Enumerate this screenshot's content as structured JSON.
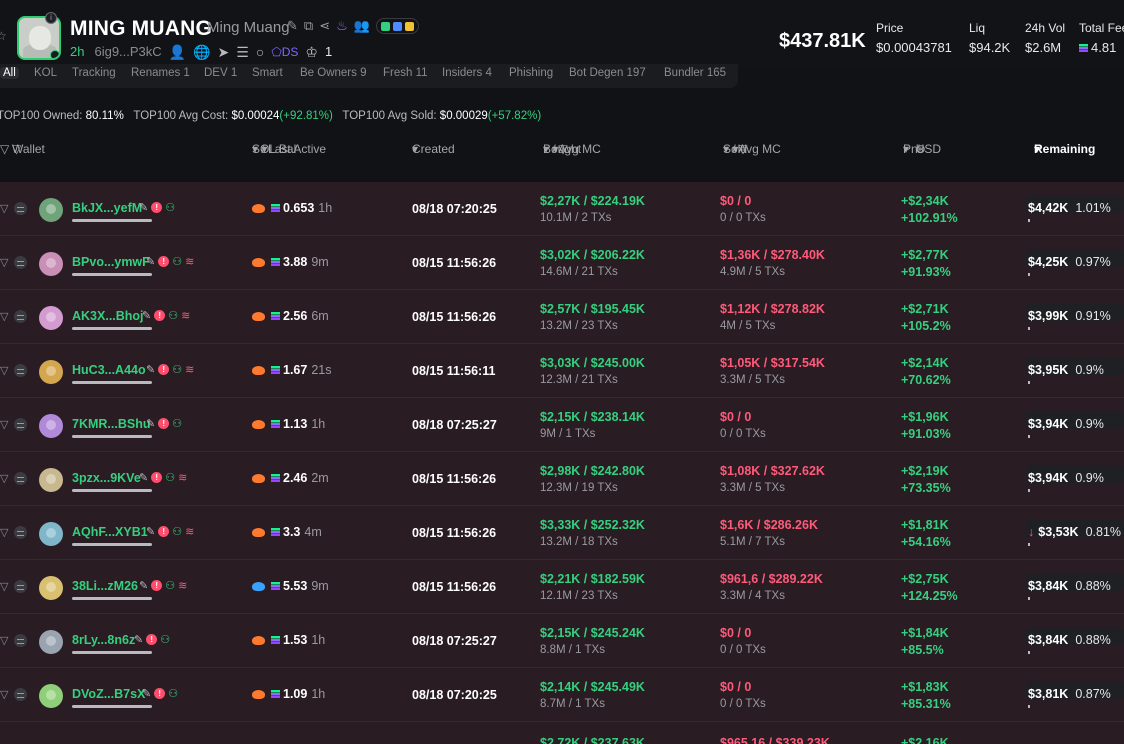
{
  "token": {
    "symbol": "MING MUANG",
    "name": "Ming Muang",
    "age": "2h",
    "contract": "6ig9...P3kC",
    "holders_icon_count": "1",
    "ds_label": "DS"
  },
  "stats": {
    "market_cap": "$437.81K",
    "price_label": "Price",
    "price": "$0.00043781",
    "liq_label": "Liq",
    "liq": "$94.2K",
    "vol_label": "24h Vol",
    "vol": "$2.6M",
    "fees_label": "Total Fee",
    "fees": "4.81"
  },
  "tabs": [
    {
      "label": "All"
    },
    {
      "label": "KOL"
    },
    {
      "label": "Tracking"
    },
    {
      "label": "Renames 1"
    },
    {
      "label": "DEV 1"
    },
    {
      "label": "Smart"
    },
    {
      "label": "Be Owners 9"
    },
    {
      "label": "Fresh 11"
    },
    {
      "label": "Insiders 4"
    },
    {
      "label": "Phishing"
    },
    {
      "label": "Bot Degen 197"
    },
    {
      "label": "Bundler 165"
    }
  ],
  "summary": {
    "owned_label": "TOP100 Owned:",
    "owned": "80.11%",
    "avg_cost_label": "TOP100 Avg Cost:",
    "avg_cost": "$0.00024",
    "avg_cost_change": "(+92.81%)",
    "avg_sold_label": "TOP100 Avg Sold:",
    "avg_sold": "$0.00029",
    "avg_sold_change": "(+57.82%)"
  },
  "columns": {
    "wallet": "Wallet",
    "sol_bal": "SOL Bal",
    "last_active": "/ Last Active",
    "created": "Created",
    "bought": "Bought",
    "bought_avg": "/ Avg MC",
    "sold": "Sold",
    "sold_avg": "/ Avg MC",
    "pnl": "Pnl",
    "usd": "USD",
    "remaining": "Remaining"
  },
  "rows": [
    {
      "wallet": "BkJX...yefM",
      "sol": "0.653",
      "active": "1h",
      "created": "08/18 07:20:25",
      "bought": "$2,27K / $224.19K",
      "bought_sub": "10.1M / 2 TXs",
      "sold": "$0 / 0",
      "sold_sub": "0 / 0 TXs",
      "pnl": "+$2,34K",
      "pnl_pct": "+102.91%",
      "remaining": "$4,42K",
      "rem_pct": "1.01%",
      "avatar_color": "#6fa37a",
      "exch": "fire",
      "layers": false,
      "down": false
    },
    {
      "wallet": "BPvo...ymwF",
      "sol": "3.88",
      "active": "9m",
      "created": "08/15 11:56:26",
      "bought": "$3,02K / $206.22K",
      "bought_sub": "14.6M / 21 TXs",
      "sold": "$1,36K / $278.40K",
      "sold_sub": "4.9M / 5 TXs",
      "pnl": "+$2,77K",
      "pnl_pct": "+91.93%",
      "remaining": "$4,25K",
      "rem_pct": "0.97%",
      "avatar_color": "#c98fb6",
      "exch": "fire",
      "layers": true,
      "down": false
    },
    {
      "wallet": "AK3X...Bhoj",
      "sol": "2.56",
      "active": "6m",
      "created": "08/15 11:56:26",
      "bought": "$2,57K / $195.45K",
      "bought_sub": "13.2M / 23 TXs",
      "sold": "$1,12K / $278.82K",
      "sold_sub": "4M / 5 TXs",
      "pnl": "+$2,71K",
      "pnl_pct": "+105.2%",
      "remaining": "$3,99K",
      "rem_pct": "0.91%",
      "avatar_color": "#d39bd0",
      "exch": "fire",
      "layers": true,
      "down": false
    },
    {
      "wallet": "HuC3...A44o",
      "sol": "1.67",
      "active": "21s",
      "created": "08/15 11:56:11",
      "bought": "$3,03K / $245.00K",
      "bought_sub": "12.3M / 21 TXs",
      "sold": "$1,05K / $317.54K",
      "sold_sub": "3.3M / 5 TXs",
      "pnl": "+$2,14K",
      "pnl_pct": "+70.62%",
      "remaining": "$3,95K",
      "rem_pct": "0.9%",
      "avatar_color": "#d4a74f",
      "exch": "fire",
      "layers": true,
      "down": false
    },
    {
      "wallet": "7KMR...BShu",
      "sol": "1.13",
      "active": "1h",
      "created": "08/18 07:25:27",
      "bought": "$2,15K / $238.14K",
      "bought_sub": "9M / 1 TXs",
      "sold": "$0 / 0",
      "sold_sub": "0 / 0 TXs",
      "pnl": "+$1,96K",
      "pnl_pct": "+91.03%",
      "remaining": "$3,94K",
      "rem_pct": "0.9%",
      "avatar_color": "#b08ad8",
      "exch": "fire",
      "layers": false,
      "down": false
    },
    {
      "wallet": "3pzx...9KVe",
      "sol": "2.46",
      "active": "2m",
      "created": "08/15 11:56:26",
      "bought": "$2,98K / $242.80K",
      "bought_sub": "12.3M / 19 TXs",
      "sold": "$1,08K / $327.62K",
      "sold_sub": "3.3M / 5 TXs",
      "pnl": "+$2,19K",
      "pnl_pct": "+73.35%",
      "remaining": "$3,94K",
      "rem_pct": "0.9%",
      "avatar_color": "#c8b890",
      "exch": "fire",
      "layers": true,
      "down": false
    },
    {
      "wallet": "AQhF...XYB1",
      "sol": "3.3",
      "active": "4m",
      "created": "08/15 11:56:26",
      "bought": "$3,33K / $252.32K",
      "bought_sub": "13.2M / 18 TXs",
      "sold": "$1,6K / $286.26K",
      "sold_sub": "5.1M / 7 TXs",
      "pnl": "+$1,81K",
      "pnl_pct": "+54.16%",
      "remaining": "$3,53K",
      "rem_pct": "0.81%",
      "avatar_color": "#7fb6c9",
      "exch": "fire",
      "layers": true,
      "down": true
    },
    {
      "wallet": "38Li...zM26",
      "sol": "5.53",
      "active": "9m",
      "created": "08/15 11:56:26",
      "bought": "$2,21K / $182.59K",
      "bought_sub": "12.1M / 23 TXs",
      "sold": "$961,6 / $289.22K",
      "sold_sub": "3.3M / 4 TXs",
      "pnl": "+$2,75K",
      "pnl_pct": "+124.25%",
      "remaining": "$3,84K",
      "rem_pct": "0.88%",
      "avatar_color": "#d8c070",
      "exch": "fish",
      "layers": true,
      "down": false
    },
    {
      "wallet": "8rLy...8n6z",
      "sol": "1.53",
      "active": "1h",
      "created": "08/18 07:25:27",
      "bought": "$2,15K / $245.24K",
      "bought_sub": "8.8M / 1 TXs",
      "sold": "$0 / 0",
      "sold_sub": "0 / 0 TXs",
      "pnl": "+$1,84K",
      "pnl_pct": "+85.5%",
      "remaining": "$3,84K",
      "rem_pct": "0.88%",
      "avatar_color": "#9aa3b0",
      "exch": "fire",
      "layers": false,
      "down": false
    },
    {
      "wallet": "DVoZ...B7sX",
      "sol": "1.09",
      "active": "1h",
      "created": "08/18 07:20:25",
      "bought": "$2,14K / $245.49K",
      "bought_sub": "8.7M / 1 TXs",
      "sold": "$0 / 0",
      "sold_sub": "0 / 0 TXs",
      "pnl": "+$1,83K",
      "pnl_pct": "+85.31%",
      "remaining": "$3,81K",
      "rem_pct": "0.87%",
      "avatar_color": "#8fcf7a",
      "exch": "fire",
      "layers": false,
      "down": false
    }
  ],
  "partial_row": {
    "bought": "$2,72K / $237.63K",
    "sold": "$965,16 / $339.23K",
    "pnl": "+$2,16K"
  },
  "colors": {
    "green": "#35d07f",
    "red": "#ff5a7a",
    "row_bg": "#2a1c23",
    "page_bg": "#111215"
  }
}
